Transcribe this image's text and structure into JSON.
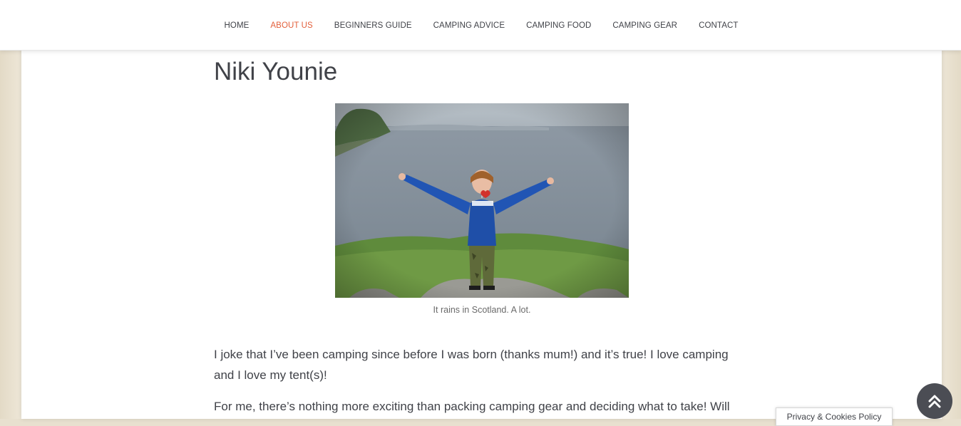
{
  "nav": {
    "items": [
      {
        "label": "HOME",
        "active": false
      },
      {
        "label": "ABOUT US",
        "active": true
      },
      {
        "label": "BEGINNERS GUIDE",
        "active": false
      },
      {
        "label": "CAMPING ADVICE",
        "active": false
      },
      {
        "label": "CAMPING FOOD",
        "active": false
      },
      {
        "label": "CAMPING GEAR",
        "active": false
      },
      {
        "label": "CONTACT",
        "active": false
      }
    ],
    "active_color": "#e35f3b"
  },
  "main": {
    "title": "Niki Younie",
    "photo_caption": "It rains in Scotland. A lot.",
    "paragraphs": [
      "I joke that I’ve been camping since before I was born (thanks mum!) and it’s true! I love camping and I love my tent(s)!",
      "For me, there’s nothing more exciting than packing camping gear and deciding what to take! Will"
    ]
  },
  "cookie_button": {
    "label": "Privacy & Cookies Policy"
  },
  "back_to_top": {
    "icon": "double-chevron-up-icon"
  },
  "colors": {
    "text": "#404248",
    "accent": "#e35f3b",
    "background": "#e8e0cf"
  }
}
